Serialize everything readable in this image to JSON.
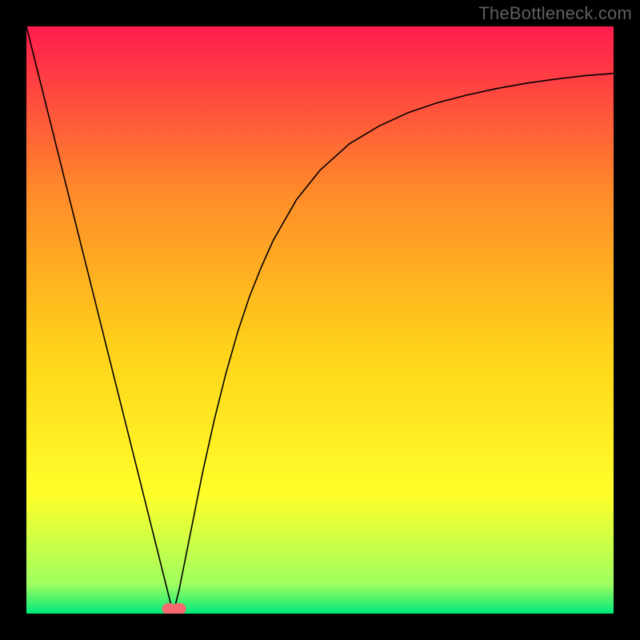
{
  "watermark": "TheBottleneck.com",
  "chart_data": {
    "type": "line",
    "title": "",
    "xlabel": "",
    "ylabel": "",
    "xlim": [
      0,
      100
    ],
    "ylim": [
      0,
      100
    ],
    "grid": false,
    "background_gradient": {
      "top": "#ff1b4e",
      "mid_upper": "#ff8a2a",
      "mid": "#ffd21a",
      "mid_lower": "#ffff2a",
      "near_bottom": "#9fff5f",
      "bottom": "#00e87a"
    },
    "series": [
      {
        "name": "bottleneck-curve",
        "x": [
          0,
          2,
          4,
          6,
          8,
          10,
          12,
          14,
          16,
          18,
          20,
          22,
          24,
          25,
          26,
          28,
          30,
          32,
          34,
          36,
          38,
          40,
          42,
          46,
          50,
          55,
          60,
          65,
          70,
          75,
          80,
          85,
          90,
          95,
          100
        ],
        "y": [
          100,
          92,
          84,
          76,
          68,
          60,
          52,
          44,
          36,
          28,
          20,
          12,
          4,
          0,
          4,
          14,
          24,
          33,
          41,
          48,
          54,
          59,
          63.5,
          70.5,
          75.5,
          80,
          83,
          85.3,
          87,
          88.3,
          89.4,
          90.3,
          91,
          91.6,
          92
        ]
      }
    ],
    "markers": [
      {
        "name": "minimum-marker-left",
        "x": 24.3,
        "y": 0.8,
        "color": "#f96a6e",
        "r": 1.2
      },
      {
        "name": "minimum-marker-right",
        "x": 26.0,
        "y": 0.8,
        "color": "#f96a6e",
        "r": 1.2
      }
    ]
  }
}
